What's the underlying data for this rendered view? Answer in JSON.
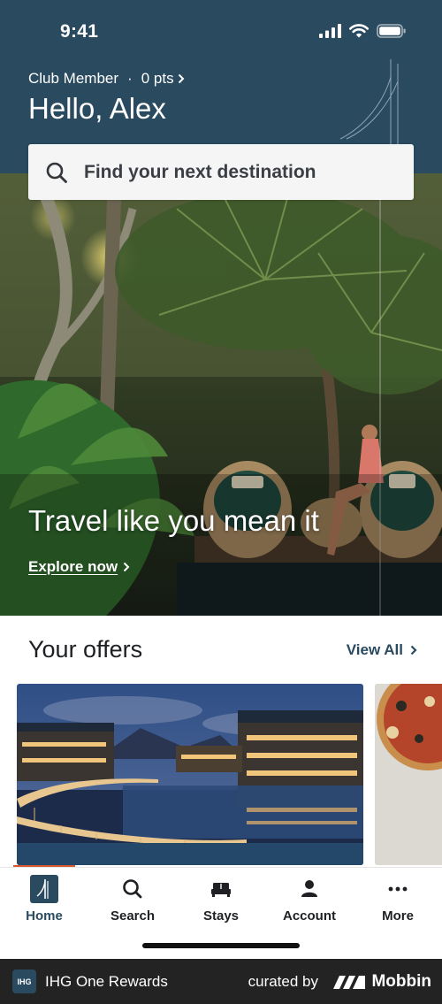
{
  "status": {
    "time": "9:41"
  },
  "header": {
    "membership": "Club Member",
    "separator": "·",
    "points": "0 pts",
    "greeting": "Hello, Alex"
  },
  "search": {
    "placeholder": "Find your next destination"
  },
  "hero": {
    "title": "Travel like you mean it",
    "link": "Explore now"
  },
  "offers": {
    "title": "Your offers",
    "view_all": "View All"
  },
  "tabs": [
    {
      "label": "Home",
      "icon": "home-logo-icon",
      "active": true
    },
    {
      "label": "Search",
      "icon": "search-icon",
      "active": false
    },
    {
      "label": "Stays",
      "icon": "bed-icon",
      "active": false
    },
    {
      "label": "Account",
      "icon": "person-icon",
      "active": false
    },
    {
      "label": "More",
      "icon": "more-dots-icon",
      "active": false
    }
  ],
  "footer": {
    "logo_text": "IHG",
    "brand": "IHG One Rewards",
    "curated": "curated by",
    "mobbin": "Mobbin"
  },
  "colors": {
    "brand": "#2a4a60",
    "accent": "#d8572f",
    "footer": "#232323"
  }
}
